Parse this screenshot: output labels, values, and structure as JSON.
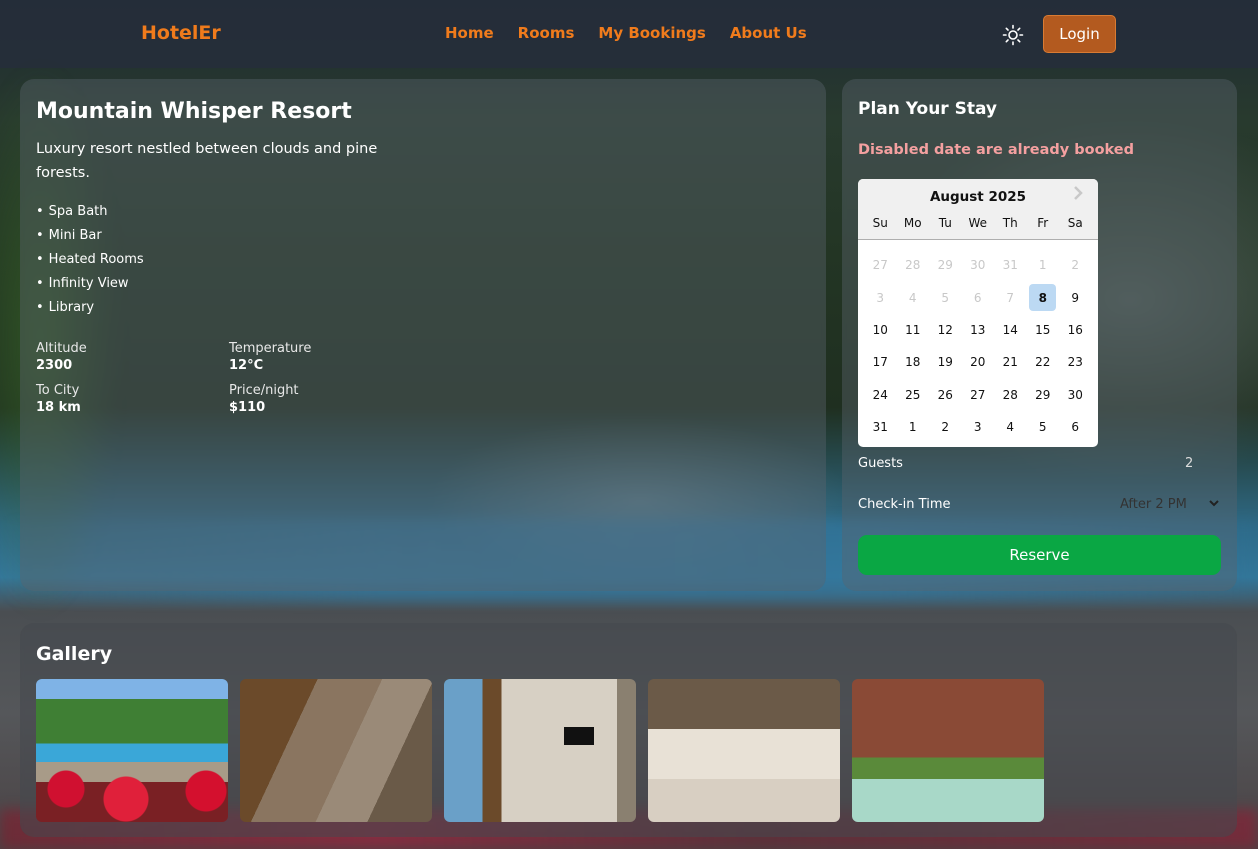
{
  "header": {
    "brand": "HotelEr",
    "nav": [
      "Home",
      "Rooms",
      "My Bookings",
      "About Us"
    ],
    "login_label": "Login"
  },
  "resort": {
    "title": "Mountain Whisper Resort",
    "description": "Luxury resort nestled between clouds and pine forests.",
    "amenities": [
      "Spa Bath",
      "Mini Bar",
      "Heated Rooms",
      "Infinity View",
      "Library"
    ],
    "stats": [
      {
        "label": "Altitude",
        "value": "2300"
      },
      {
        "label": "Temperature",
        "value": "12°C"
      },
      {
        "label": "To City",
        "value": "18 km"
      },
      {
        "label": "Price/night",
        "value": "$110"
      }
    ]
  },
  "booking": {
    "title": "Plan Your Stay",
    "booked_note": "Disabled date are already booked",
    "calendar": {
      "month": "August 2025",
      "weekdays": [
        "Su",
        "Mo",
        "Tu",
        "We",
        "Th",
        "Fr",
        "Sa"
      ],
      "weeks": [
        [
          "27",
          "28",
          "29",
          "30",
          "31",
          "1",
          "2"
        ],
        [
          "3",
          "4",
          "5",
          "6",
          "7",
          "8",
          "9"
        ],
        [
          "10",
          "11",
          "12",
          "13",
          "14",
          "15",
          "16"
        ],
        [
          "17",
          "18",
          "19",
          "20",
          "21",
          "22",
          "23"
        ],
        [
          "24",
          "25",
          "26",
          "27",
          "28",
          "29",
          "30"
        ],
        [
          "31",
          "1",
          "2",
          "3",
          "4",
          "5",
          "6"
        ]
      ],
      "selected": "8"
    },
    "guests_label": "Guests",
    "guests_value": "2",
    "checkin_label": "Check-in Time",
    "checkin_value": "After 2 PM",
    "reserve_label": "Reserve"
  },
  "gallery": {
    "title": "Gallery",
    "images": [
      "pool-with-flowers",
      "stone-patio",
      "living-room",
      "bedroom",
      "terrace-pool"
    ]
  },
  "colors": {
    "accent": "#f07b1c",
    "login_bg": "#b35a1f",
    "reserve_bg": "#0aa744",
    "booked_note": "#f4a0a0",
    "selected_day": "#bcd9f3"
  }
}
